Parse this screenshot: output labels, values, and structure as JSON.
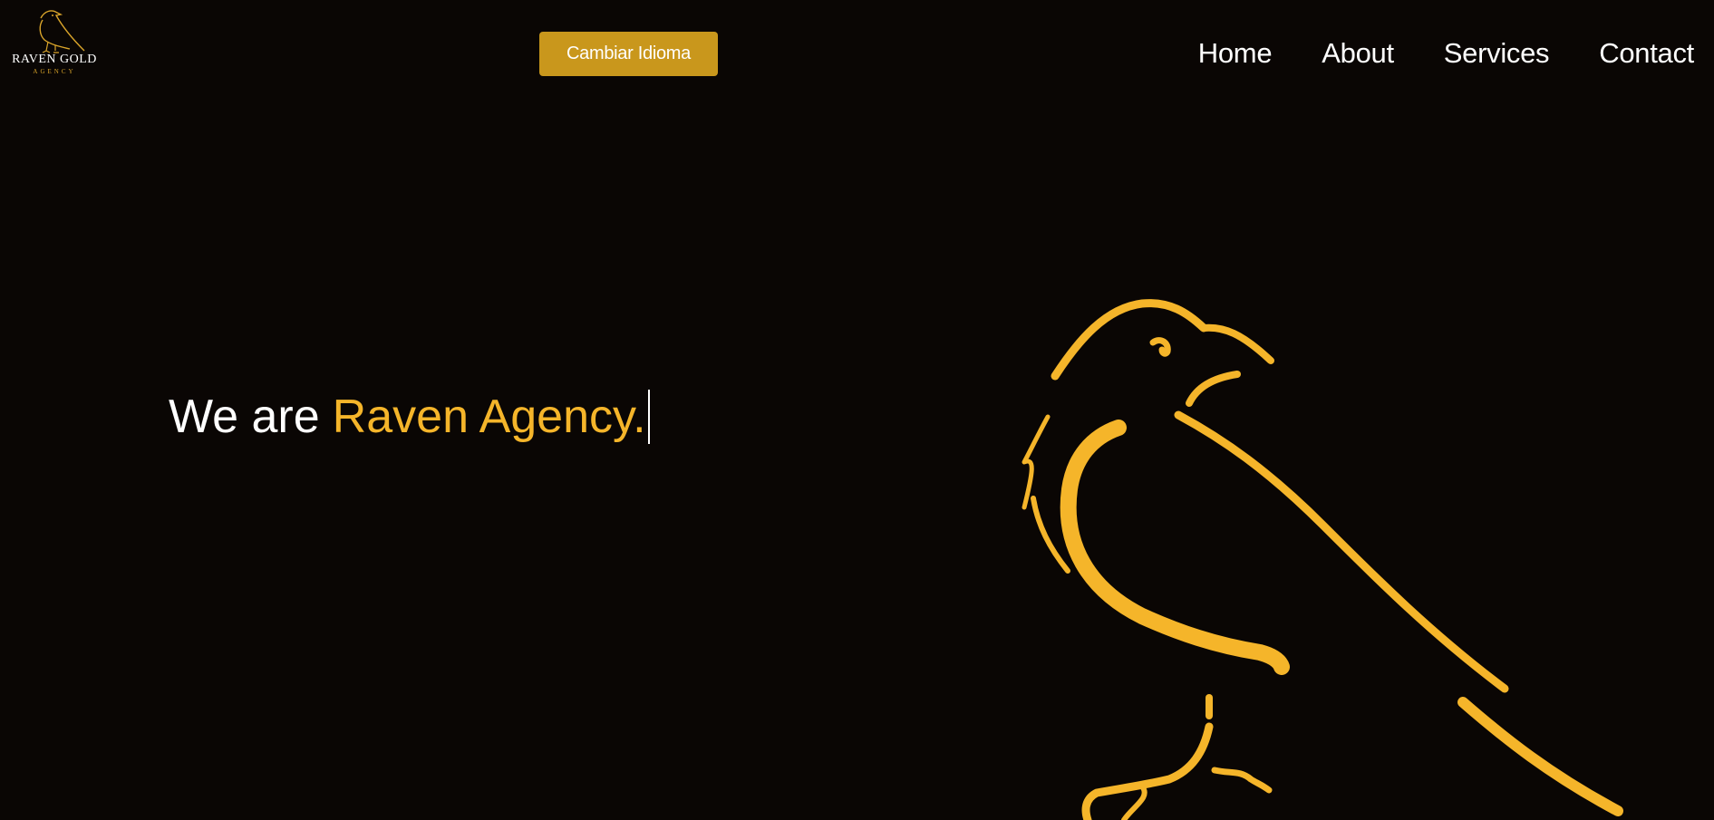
{
  "logo": {
    "name": "RAVEN GOLD",
    "sub": "AGENCY"
  },
  "header": {
    "lang_button": "Cambiar Idioma"
  },
  "nav": {
    "items": [
      "Home",
      "About",
      "Services",
      "Contact"
    ]
  },
  "hero": {
    "prefix": "We are",
    "accent": "Raven Agency."
  },
  "colors": {
    "background": "#0a0604",
    "gold": "#f5b52a",
    "button": "#c9971c"
  }
}
